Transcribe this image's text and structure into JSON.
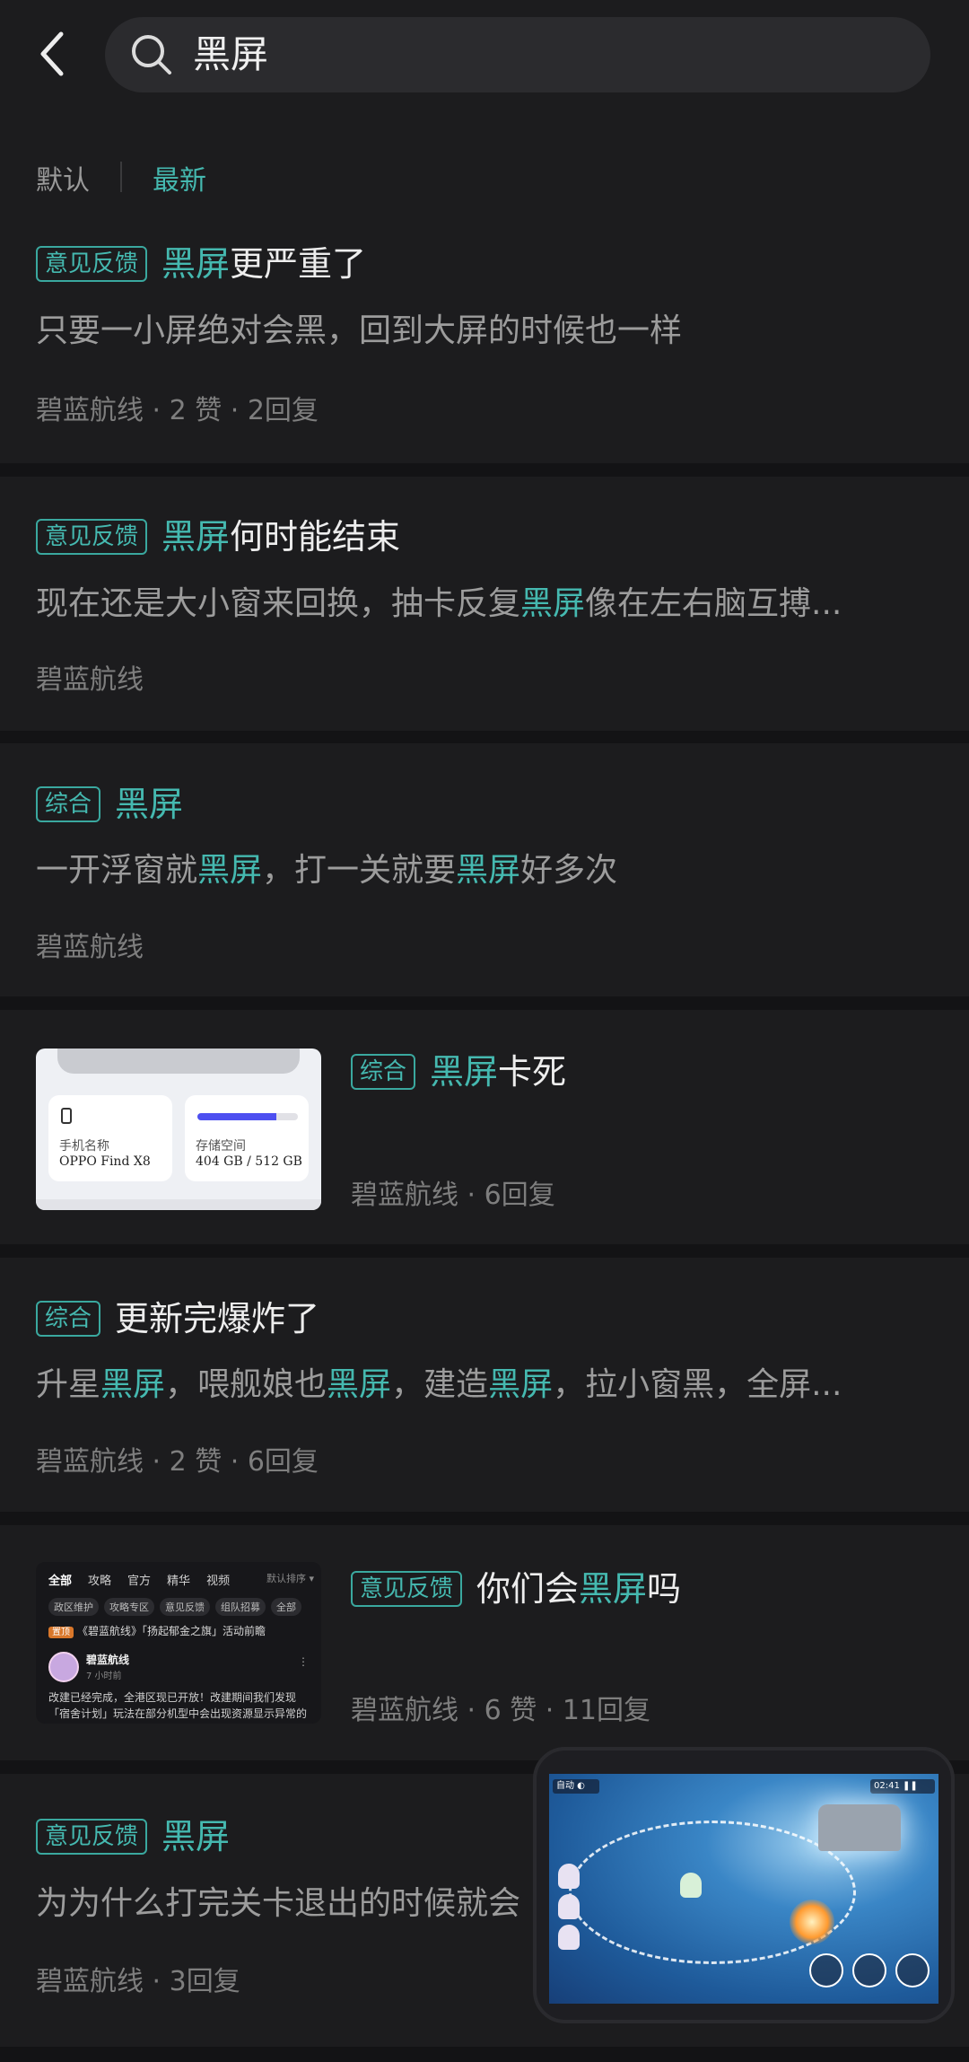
{
  "search": {
    "query": "黑屏"
  },
  "sort": {
    "default": "默认",
    "latest": "最新"
  },
  "posts": [
    {
      "tag": "意见反馈",
      "title_parts": [
        {
          "text": "黑屏",
          "hl": true
        },
        {
          "text": "更严重了",
          "hl": false
        }
      ],
      "snippet_parts": [
        {
          "text": "只要一小屏绝对会黑，回到大屏的时候也一样",
          "hl": false
        }
      ],
      "meta": "碧蓝航线 · 2 赞 · 2回复"
    },
    {
      "tag": "意见反馈",
      "title_parts": [
        {
          "text": "黑屏",
          "hl": true
        },
        {
          "text": "何时能结束",
          "hl": false
        }
      ],
      "snippet_parts": [
        {
          "text": "现在还是大小窗来回换，抽卡反复",
          "hl": false
        },
        {
          "text": "黑屏",
          "hl": true
        },
        {
          "text": "像在左右脑互搏...",
          "hl": false
        }
      ],
      "meta": "碧蓝航线"
    },
    {
      "tag": "综合",
      "title_parts": [
        {
          "text": "黑屏",
          "hl": true
        }
      ],
      "snippet_parts": [
        {
          "text": "一开浮窗就",
          "hl": false
        },
        {
          "text": "黑屏",
          "hl": true
        },
        {
          "text": "，打一关就要",
          "hl": false
        },
        {
          "text": "黑屏",
          "hl": true
        },
        {
          "text": "好多次",
          "hl": false
        }
      ],
      "meta": "碧蓝航线"
    },
    {
      "tag": "综合",
      "title_parts": [
        {
          "text": "黑屏",
          "hl": true
        },
        {
          "text": "卡死",
          "hl": false
        }
      ],
      "meta": "碧蓝航线 · 6回复",
      "thumb": {
        "device_label": "手机名称",
        "device_value": "OPPO Find X8",
        "storage_label": "存储空间",
        "storage_value": "404 GB / 512 GB",
        "storage_fraction": 0.79
      }
    },
    {
      "tag": "综合",
      "title_parts": [
        {
          "text": "更新完爆炸了",
          "hl": false
        }
      ],
      "snippet_parts": [
        {
          "text": "升星",
          "hl": false
        },
        {
          "text": "黑屏",
          "hl": true
        },
        {
          "text": "，喂舰娘也",
          "hl": false
        },
        {
          "text": "黑屏",
          "hl": true
        },
        {
          "text": "，建造",
          "hl": false
        },
        {
          "text": "黑屏",
          "hl": true
        },
        {
          "text": "，拉小窗黑，全屏...",
          "hl": false
        }
      ],
      "meta": "碧蓝航线 · 2 赞 · 6回复"
    },
    {
      "tag": "意见反馈",
      "title_parts": [
        {
          "text": "你们会",
          "hl": false
        },
        {
          "text": "黑屏",
          "hl": true
        },
        {
          "text": "吗",
          "hl": false
        }
      ],
      "meta": "碧蓝航线 · 6 赞 · 11回复",
      "thumb": {
        "tabs": [
          "全部",
          "攻略",
          "官方",
          "精华",
          "视频"
        ],
        "sort": "默认排序 ▾",
        "chips": [
          "政区维护",
          "攻略专区",
          "意见反馈",
          "组队招募",
          "全部"
        ],
        "notice_badge": "置顶",
        "notice": "《碧蓝航线》「扬起郁金之旗」活动前瞻",
        "user": "碧蓝航线",
        "time": "7 小时前",
        "body1": "改建已经完成，全港区现已开放！改建期间我们发现",
        "body2": "「宿舍计划」玩法在部分机型中会出现资源显示异常的"
      }
    },
    {
      "tag": "意见反馈",
      "title_parts": [
        {
          "text": "黑屏",
          "hl": true
        }
      ],
      "snippet_parts": [
        {
          "text": "为为什么打完关卡退出的时候就会",
          "hl": false
        }
      ],
      "meta": "碧蓝航线 · 3回复"
    }
  ],
  "pip": {
    "hud_left": "自动 ◐",
    "hud_right": "02:41 ❚❚"
  }
}
